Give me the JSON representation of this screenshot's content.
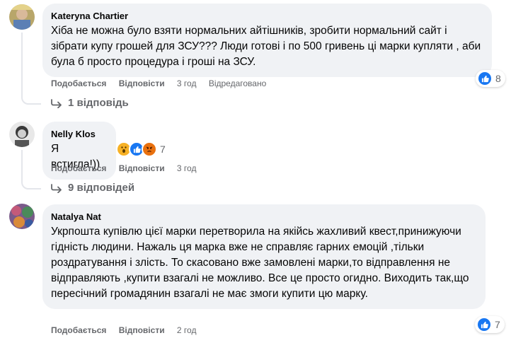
{
  "comments": [
    {
      "author": "Kateryna Chartier",
      "text": "Хіба не можна було взяти нормальних айтішників, зробити нормальний сайт і зібрати купу грошей для ЗСУ??? Люди готові і по 500 гривень ці марки купляти , аби була б просто процедура і гроші на ЗСУ.",
      "like_label": "Подобається",
      "reply_label": "Відповісти",
      "time": "3 год",
      "edited": "Відредаговано",
      "reaction_count": "8",
      "replies": "1 відповідь"
    },
    {
      "author": "Nelly Klos",
      "text": "Я встигла!))",
      "like_label": "Подобається",
      "reply_label": "Відповісти",
      "time": "3 год",
      "reaction_count": "7",
      "replies": "9 відповідей"
    },
    {
      "author": "Natalya Nat",
      "text": "Укрпошта купівлю цієї марки перетворила на якійсь жахливий квест,принижуючи гідність людини. Нажаль ця марка вже не справляє гарних емоцій ,тільки роздратування і злість. То скасовано вже замовлені марки,то відправлення не відправляють ,купити взагалі не можливо. Все це просто огидно. Виходить так,що пересічний громадянин взагалі не має змоги купити цю марку.",
      "like_label": "Подобається",
      "reply_label": "Відповісти",
      "time": "2 год",
      "reaction_count": "7"
    }
  ],
  "colors": {
    "like_blue": "#1877f2",
    "bubble_bg": "#f0f2f5",
    "secondary_text": "#65676b"
  }
}
